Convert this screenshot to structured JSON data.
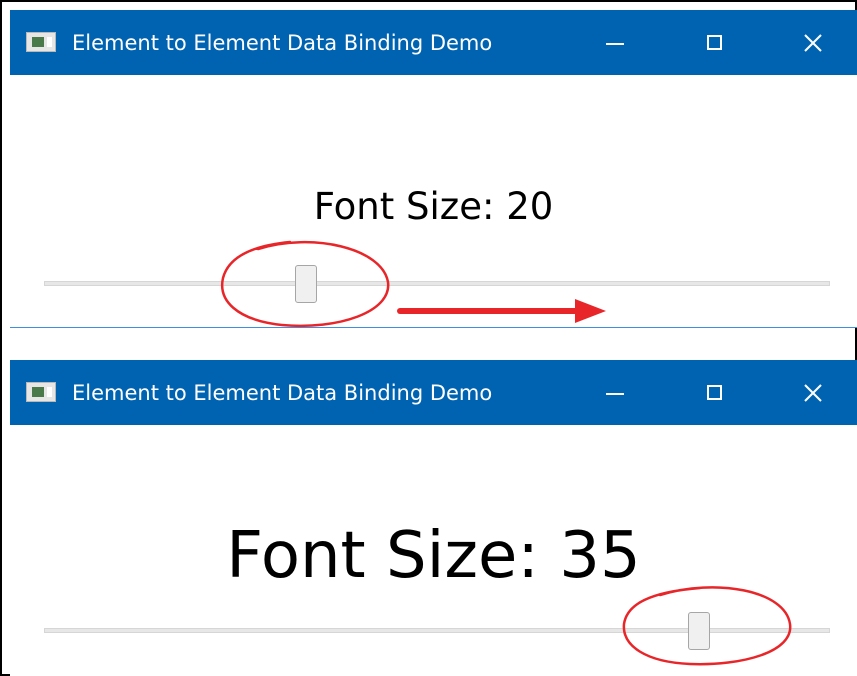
{
  "colors": {
    "titlebar": "#0063b1",
    "annotation": "#e8262a",
    "window_border": "#3f8ee0"
  },
  "icons": {
    "app": "app-window-icon",
    "minimize": "minimize-icon",
    "maximize": "maximize-icon",
    "close": "close-icon"
  },
  "windows": [
    {
      "title": "Element to Element Data Binding Demo",
      "label": "Font Size: 20",
      "slider_value": 20
    },
    {
      "title": "Element to Element Data Binding Demo",
      "label": "Font Size: 35",
      "slider_value": 35
    }
  ]
}
